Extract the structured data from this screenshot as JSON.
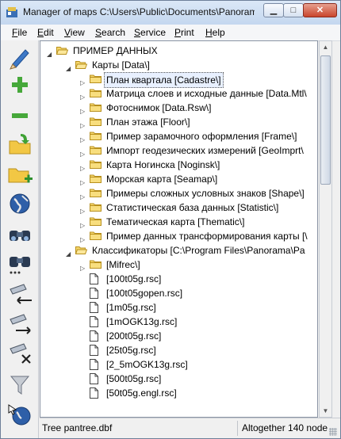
{
  "window": {
    "title": "Manager of maps C:\\Users\\Public\\Documents\\Panorama"
  },
  "menu": [
    {
      "label": "File",
      "key": "F",
      "rest": "ile"
    },
    {
      "label": "Edit",
      "key": "E",
      "rest": "dit"
    },
    {
      "label": "View",
      "key": "V",
      "rest": "iew"
    },
    {
      "label": "Search",
      "key": "S",
      "rest": "earch"
    },
    {
      "label": "Service",
      "key": "S",
      "rest": "ervice"
    },
    {
      "label": "Print",
      "key": "P",
      "rest": "rint"
    },
    {
      "label": "Help",
      "key": "H",
      "rest": "elp"
    }
  ],
  "toolbar": [
    {
      "name": "pencil-icon"
    },
    {
      "name": "plus-icon"
    },
    {
      "name": "minus-icon"
    },
    {
      "name": "open-folder-icon"
    },
    {
      "name": "add-folder-icon"
    },
    {
      "name": "globe-icon"
    },
    {
      "name": "binoculars-icon"
    },
    {
      "name": "binoculars-more-icon"
    },
    {
      "name": "flashlight-left-icon"
    },
    {
      "name": "flashlight-right-icon"
    },
    {
      "name": "flashlight-delete-icon"
    },
    {
      "name": "filter-icon"
    },
    {
      "name": "globe-pointer-icon"
    }
  ],
  "tree": [
    {
      "level": 0,
      "type": "open-folder",
      "expand": "open",
      "text": "ПРИМЕР ДАННЫХ"
    },
    {
      "level": 1,
      "type": "open-folder",
      "expand": "open",
      "text": "Карты [Data\\]"
    },
    {
      "level": 2,
      "type": "folder",
      "expand": "closed",
      "text": "План квартала [Cadastre\\]",
      "selected": true
    },
    {
      "level": 2,
      "type": "folder",
      "expand": "closed",
      "text": "Матрица слоев и исходные данные [Data.Mtl\\"
    },
    {
      "level": 2,
      "type": "folder",
      "expand": "closed",
      "text": "Фотоснимок [Data.Rsw\\]"
    },
    {
      "level": 2,
      "type": "folder",
      "expand": "closed",
      "text": "План этажа [Floor\\]"
    },
    {
      "level": 2,
      "type": "folder",
      "expand": "closed",
      "text": "Пример зарамочного оформления [Frame\\]"
    },
    {
      "level": 2,
      "type": "folder",
      "expand": "closed",
      "text": "Импорт геодезических измерений [GeoImprt\\"
    },
    {
      "level": 2,
      "type": "folder",
      "expand": "closed",
      "text": "Карта Ногинска [Noginsk\\]"
    },
    {
      "level": 2,
      "type": "folder",
      "expand": "closed",
      "text": "Морская карта [Seamap\\]"
    },
    {
      "level": 2,
      "type": "folder",
      "expand": "closed",
      "text": "Примеры сложных условных знаков [Shape\\]"
    },
    {
      "level": 2,
      "type": "folder",
      "expand": "closed",
      "text": "Статистическая база данных [Statistic\\]"
    },
    {
      "level": 2,
      "type": "folder",
      "expand": "closed",
      "text": "Тематическая карта [Thematic\\]"
    },
    {
      "level": 2,
      "type": "folder",
      "expand": "closed",
      "text": "Пример данных трансформирования карты [\\"
    },
    {
      "level": 1,
      "type": "open-folder",
      "expand": "open",
      "text": "Классификаторы [C:\\Program Files\\Panorama\\Pa"
    },
    {
      "level": 2,
      "type": "folder",
      "expand": "closed",
      "text": "[Mifrec\\]"
    },
    {
      "level": 2,
      "type": "doc",
      "expand": "",
      "text": "[100t05g.rsc]"
    },
    {
      "level": 2,
      "type": "doc",
      "expand": "",
      "text": "[100t05gopen.rsc]"
    },
    {
      "level": 2,
      "type": "doc",
      "expand": "",
      "text": "[1m05g.rsc]"
    },
    {
      "level": 2,
      "type": "doc",
      "expand": "",
      "text": "[1mOGK13g.rsc]"
    },
    {
      "level": 2,
      "type": "doc",
      "expand": "",
      "text": "[200t05g.rsc]"
    },
    {
      "level": 2,
      "type": "doc",
      "expand": "",
      "text": "[25t05g.rsc]"
    },
    {
      "level": 2,
      "type": "doc",
      "expand": "",
      "text": "[2_5mOGK13g.rsc]"
    },
    {
      "level": 2,
      "type": "doc",
      "expand": "",
      "text": "[500t05g.rsc]"
    },
    {
      "level": 2,
      "type": "doc",
      "expand": "",
      "text": "[50t05g.engl.rsc]"
    }
  ],
  "status": {
    "left": "Tree pantree.dbf",
    "right": "Altogether 140 node"
  },
  "colors": {
    "folder": "#f5d66b",
    "folder_edge": "#b8901e",
    "selection": "#e8f0ff"
  }
}
